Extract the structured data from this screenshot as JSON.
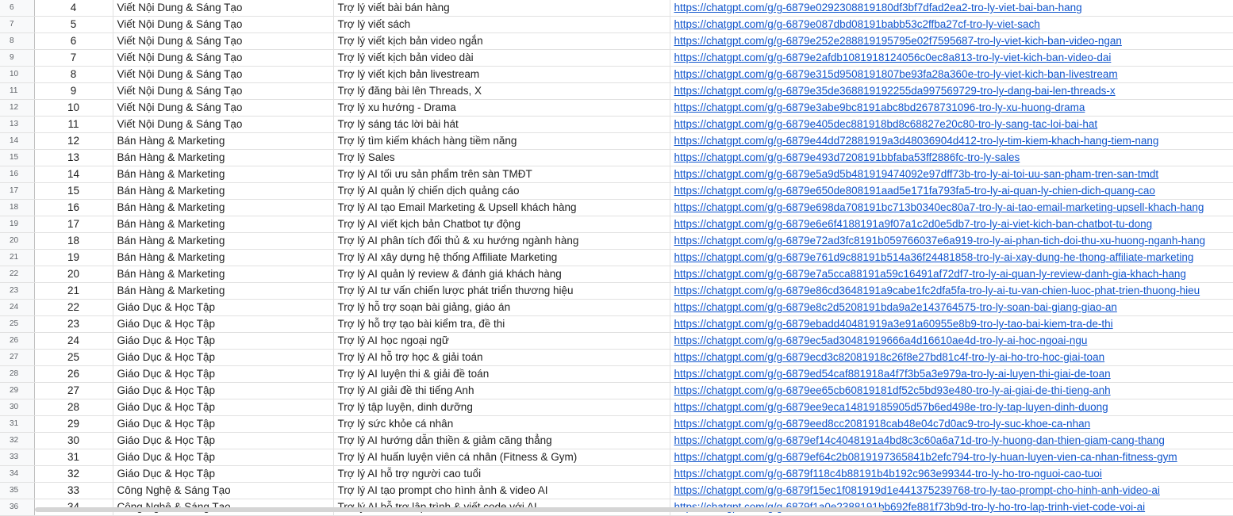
{
  "sheet": {
    "rows": [
      {
        "row": "6",
        "stt": "4",
        "category": "Viết Nội Dung & Sáng Tạo",
        "name": "Trợ lý viết bài bán hàng",
        "link": "https://chatgpt.com/g/g-6879e0292308819180df3bf7dfad2ea2-tro-ly-viet-bai-ban-hang"
      },
      {
        "row": "7",
        "stt": "5",
        "category": "Viết Nội Dung & Sáng Tạo",
        "name": "Trợ lý viết sách",
        "link": "https://chatgpt.com/g/g-6879e087dbd08191babb53c2ffba27cf-tro-ly-viet-sach"
      },
      {
        "row": "8",
        "stt": "6",
        "category": "Viết Nội Dung & Sáng Tạo",
        "name": "Trợ lý viết kịch bản video ngắn",
        "link": "https://chatgpt.com/g/g-6879e252e288819195795e02f7595687-tro-ly-viet-kich-ban-video-ngan"
      },
      {
        "row": "9",
        "stt": "7",
        "category": "Viết Nội Dung & Sáng Tạo",
        "name": "Trợ lý viết kịch bản video dài",
        "link": "https://chatgpt.com/g/g-6879e2afdb1081918124056c0ec8a813-tro-ly-viet-kich-ban-video-dai"
      },
      {
        "row": "10",
        "stt": "8",
        "category": "Viết Nội Dung & Sáng Tạo",
        "name": "Trợ lý viết kịch bản livestream",
        "link": "https://chatgpt.com/g/g-6879e315d9508191807be93fa28a360e-tro-ly-viet-kich-ban-livestream"
      },
      {
        "row": "11",
        "stt": "9",
        "category": "Viết Nội Dung & Sáng Tạo",
        "name": "Trợ lý đăng bài lên Threads, X",
        "link": "https://chatgpt.com/g/g-6879e35de368819192255da997569729-tro-ly-dang-bai-len-threads-x"
      },
      {
        "row": "12",
        "stt": "10",
        "category": "Viết Nội Dung & Sáng Tạo",
        "name": "Trợ lý xu hướng - Drama",
        "link": "https://chatgpt.com/g/g-6879e3abe9bc8191abc8bd2678731096-tro-ly-xu-huong-drama"
      },
      {
        "row": "13",
        "stt": "11",
        "category": "Viết Nội Dung & Sáng Tạo",
        "name": "Trợ lý sáng tác lời bài hát",
        "link": "https://chatgpt.com/g/g-6879e405dec881918bd8c68827e20c80-tro-ly-sang-tac-loi-bai-hat"
      },
      {
        "row": "14",
        "stt": "12",
        "category": "Bán Hàng & Marketing",
        "name": "Trợ lý tìm kiếm khách hàng tiềm năng",
        "link": "https://chatgpt.com/g/g-6879e44dd72881919a3d48036904d412-tro-ly-tim-kiem-khach-hang-tiem-nang"
      },
      {
        "row": "15",
        "stt": "13",
        "category": "Bán Hàng & Marketing",
        "name": "Trợ lý Sales",
        "link": "https://chatgpt.com/g/g-6879e493d7208191bbfaba53ff2886fc-tro-ly-sales"
      },
      {
        "row": "16",
        "stt": "14",
        "category": "Bán Hàng & Marketing",
        "name": "Trợ lý AI tối ưu sản phẩm trên sàn TMĐT",
        "link": "https://chatgpt.com/g/g-6879e5a9d5b481919474092e97dff73b-tro-ly-ai-toi-uu-san-pham-tren-san-tmdt"
      },
      {
        "row": "17",
        "stt": "15",
        "category": "Bán Hàng & Marketing",
        "name": "Trợ lý AI quản lý chiến dịch quảng cáo",
        "link": "https://chatgpt.com/g/g-6879e650de808191aad5e171fa793fa5-tro-ly-ai-quan-ly-chien-dich-quang-cao"
      },
      {
        "row": "18",
        "stt": "16",
        "category": "Bán Hàng & Marketing",
        "name": "Trợ lý AI tạo Email Marketing & Upsell khách hàng",
        "link": "https://chatgpt.com/g/g-6879e698da708191bc713b0340ec80a7-tro-ly-ai-tao-email-marketing-upsell-khach-hang"
      },
      {
        "row": "19",
        "stt": "17",
        "category": "Bán Hàng & Marketing",
        "name": "Trợ lý AI viết kịch bản Chatbot tự động",
        "link": "https://chatgpt.com/g/g-6879e6e6f4188191a9f07a1c2d0e5db7-tro-ly-ai-viet-kich-ban-chatbot-tu-dong"
      },
      {
        "row": "20",
        "stt": "18",
        "category": "Bán Hàng & Marketing",
        "name": "Trợ lý AI phân tích đối thủ & xu hướng ngành hàng",
        "link": "https://chatgpt.com/g/g-6879e72ad3fc8191b059766037e6a919-tro-ly-ai-phan-tich-doi-thu-xu-huong-nganh-hang"
      },
      {
        "row": "21",
        "stt": "19",
        "category": "Bán Hàng & Marketing",
        "name": "Trợ lý AI xây dựng hệ thống Affiliate Marketing",
        "link": "https://chatgpt.com/g/g-6879e761d9c88191b514a36f24481858-tro-ly-ai-xay-dung-he-thong-affiliate-marketing"
      },
      {
        "row": "22",
        "stt": "20",
        "category": "Bán Hàng & Marketing",
        "name": "Trợ lý AI quản lý review & đánh giá khách hàng",
        "link": "https://chatgpt.com/g/g-6879e7a5cca88191a59c16491af72df7-tro-ly-ai-quan-ly-review-danh-gia-khach-hang"
      },
      {
        "row": "23",
        "stt": "21",
        "category": "Bán Hàng & Marketing",
        "name": "Trợ lý AI tư vấn chiến lược phát triển thương hiệu",
        "link": "https://chatgpt.com/g/g-6879e86cd3648191a9cabe1fc2dfa5fa-tro-ly-ai-tu-van-chien-luoc-phat-trien-thuong-hieu"
      },
      {
        "row": "24",
        "stt": "22",
        "category": "Giáo Dục & Học Tập",
        "name": "Trợ lý hỗ trợ soạn bài giảng, giáo án",
        "link": "https://chatgpt.com/g/g-6879e8c2d5208191bda9a2e143764575-tro-ly-soan-bai-giang-giao-an"
      },
      {
        "row": "25",
        "stt": "23",
        "category": "Giáo Dục & Học Tập",
        "name": "Trợ lý hỗ trợ tạo bài kiểm tra, đề thi",
        "link": "https://chatgpt.com/g/g-6879ebadd40481919a3e91a60955e8b9-tro-ly-tao-bai-kiem-tra-de-thi"
      },
      {
        "row": "26",
        "stt": "24",
        "category": "Giáo Dục & Học Tập",
        "name": "Trợ lý AI học ngoại ngữ",
        "link": "https://chatgpt.com/g/g-6879ec5ad30481919666a4d16610ae4d-tro-ly-ai-hoc-ngoai-ngu"
      },
      {
        "row": "27",
        "stt": "25",
        "category": "Giáo Dục & Học Tập",
        "name": "Trợ lý AI hỗ trợ học & giải toán",
        "link": "https://chatgpt.com/g/g-6879ecd3c82081918c26f8e27bd81c4f-tro-ly-ai-ho-tro-hoc-giai-toan"
      },
      {
        "row": "28",
        "stt": "26",
        "category": "Giáo Dục & Học Tập",
        "name": "Trợ lý AI luyện thi & giải đề toán",
        "link": "https://chatgpt.com/g/g-6879ed54caf881918a4f7f3b5a3e979a-tro-ly-ai-luyen-thi-giai-de-toan"
      },
      {
        "row": "29",
        "stt": "27",
        "category": "Giáo Dục & Học Tập",
        "name": "Trợ lý AI giải đề thi tiếng Anh",
        "link": "https://chatgpt.com/g/g-6879ee65cb60819181df52c5bd93e480-tro-ly-ai-giai-de-thi-tieng-anh"
      },
      {
        "row": "30",
        "stt": "28",
        "category": "Giáo Dục & Học Tập",
        "name": "Trợ lý tập luyện, dinh dưỡng",
        "link": "https://chatgpt.com/g/g-6879ee9eca14819185905d57b6ed498e-tro-ly-tap-luyen-dinh-duong"
      },
      {
        "row": "31",
        "stt": "29",
        "category": "Giáo Dục & Học Tập",
        "name": "Trợ lý sức khỏe cá nhân",
        "link": "https://chatgpt.com/g/g-6879eed8cc2081918cab48e04c7d0ac9-tro-ly-suc-khoe-ca-nhan"
      },
      {
        "row": "32",
        "stt": "30",
        "category": "Giáo Dục & Học Tập",
        "name": "Trợ lý AI hướng dẫn thiền & giảm căng thẳng",
        "link": "https://chatgpt.com/g/g-6879ef14c4048191a4bd8c3c60a6a71d-tro-ly-huong-dan-thien-giam-cang-thang"
      },
      {
        "row": "33",
        "stt": "31",
        "category": "Giáo Dục & Học Tập",
        "name": "Trợ lý AI huấn luyện viên cá nhân (Fitness & Gym)",
        "link": "https://chatgpt.com/g/g-6879ef64c2b0819197365841b2efc794-tro-ly-huan-luyen-vien-ca-nhan-fitness-gym"
      },
      {
        "row": "34",
        "stt": "32",
        "category": "Giáo Dục & Học Tập",
        "name": "Trợ lý AI hỗ trợ người cao tuổi",
        "link": "https://chatgpt.com/g/g-6879f118c4b88191b4b192c963e99344-tro-ly-ho-tro-nguoi-cao-tuoi"
      },
      {
        "row": "35",
        "stt": "33",
        "category": "Công Nghệ & Sáng Tạo",
        "name": "Trợ lý AI tạo prompt cho hình ảnh & video AI",
        "link": "https://chatgpt.com/g/g-6879f15ec1f081919d1e441375239768-tro-ly-tao-prompt-cho-hinh-anh-video-ai"
      },
      {
        "row": "36",
        "stt": "34",
        "category": "Công Nghệ & Sáng Tạo",
        "name": "Trợ lý AI hỗ trợ lập trình & viết code với AI",
        "link": "https://chatgpt.com/g/g-6879f1a0e2388191bb692fe881f73b9d-tro-ly-ho-tro-lap-trinh-viet-code-voi-ai"
      }
    ]
  },
  "colors": {
    "link": "#1155cc",
    "grid": "#e1e1e1",
    "row_header_bg": "#f8f9fa"
  }
}
